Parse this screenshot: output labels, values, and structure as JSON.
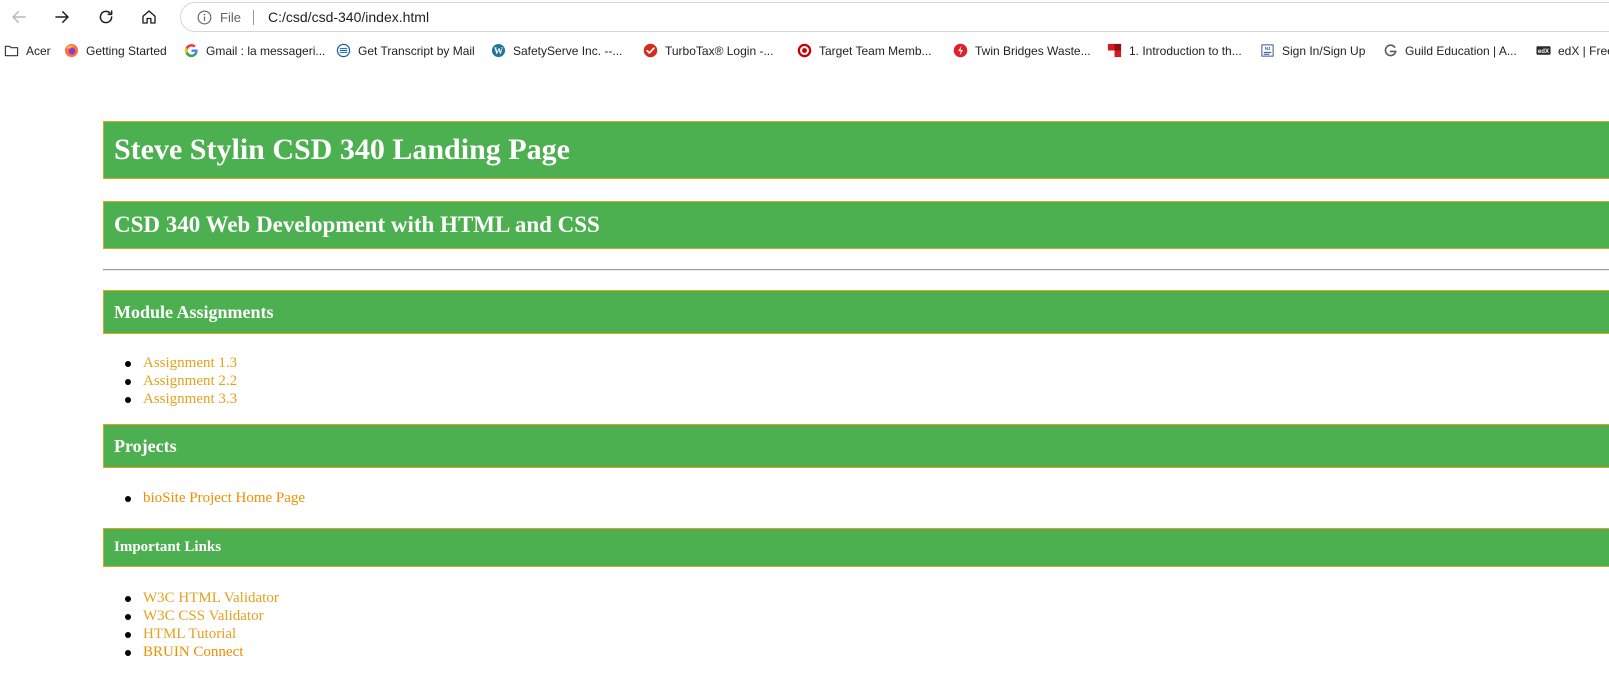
{
  "browser": {
    "omnibox": {
      "scheme_label": "File",
      "url": "C:/csd/csd-340/index.html"
    },
    "bookmarks": [
      {
        "label": "Acer",
        "icon": "folder-icon"
      },
      {
        "label": "Getting Started",
        "icon": "firefox-icon"
      },
      {
        "label": "Gmail : la messageri...",
        "icon": "google-icon"
      },
      {
        "label": "Get Transcript by Mail",
        "icon": "irs-icon"
      },
      {
        "label": "SafetyServe Inc. --...",
        "icon": "wordpress-icon"
      },
      {
        "label": "TurboTax® Login -...",
        "icon": "turbotax-icon"
      },
      {
        "label": "Target Team Memb...",
        "icon": "target-icon"
      },
      {
        "label": "Twin Bridges Waste...",
        "icon": "bolt-icon"
      },
      {
        "label": "1. Introduction to th...",
        "icon": "red-square-icon"
      },
      {
        "label": "Sign In/Sign Up",
        "icon": "signin-icon"
      },
      {
        "label": "Guild Education | A...",
        "icon": "guild-icon"
      },
      {
        "label": "edX | Free",
        "icon": "edx-icon"
      }
    ]
  },
  "page": {
    "title": "Steve Stylin CSD 340 Landing Page",
    "course": "CSD 340 Web Development with HTML and CSS",
    "modules": {
      "heading": "Module Assignments",
      "items": [
        "Assignment 1.3",
        "Assignment 2.2",
        "Assignment 3.3"
      ]
    },
    "projects": {
      "heading": "Projects",
      "items": [
        "bioSite Project Home Page"
      ]
    },
    "links": {
      "heading": "Important Links",
      "items": [
        "W3C HTML Validator",
        "W3C CSS Validator",
        "HTML Tutorial",
        "BRUIN Connect"
      ]
    }
  },
  "colors": {
    "band_green": "#4caf50",
    "band_border": "#e2a21e",
    "link_gold": "#e2a21e",
    "link_orange": "#ef8f00"
  }
}
